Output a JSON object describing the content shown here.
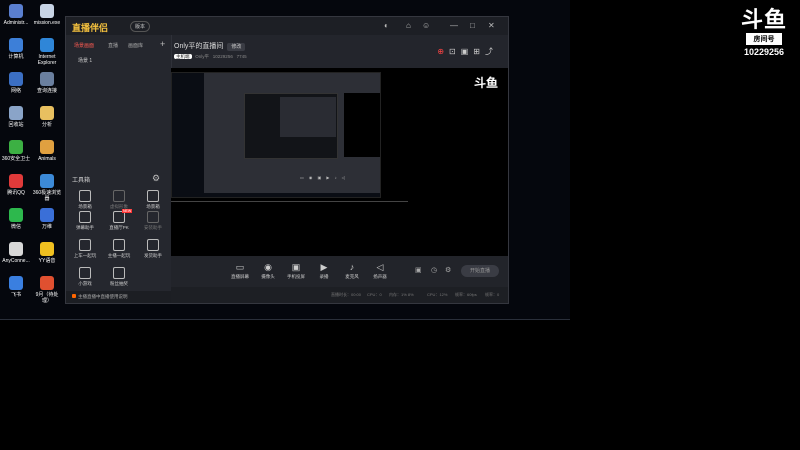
{
  "desktop": {
    "icons": [
      {
        "label": "Administr...",
        "color": "#5a7fd0"
      },
      {
        "label": "mission.exe",
        "color": "#c8d4e6"
      },
      {
        "label": "计算机",
        "color": "#3d7fd8"
      },
      {
        "label": "Internet Explorer",
        "color": "#2f86d8"
      },
      {
        "label": "网络",
        "color": "#3b6fc4"
      },
      {
        "label": "查询连接",
        "color": "#6a7f9f"
      },
      {
        "label": "回收站",
        "color": "#8aa4c8"
      },
      {
        "label": "分析",
        "color": "#e8c060"
      },
      {
        "label": "360安全卫士",
        "color": "#3cb043"
      },
      {
        "label": "Animals",
        "color": "#e0a040"
      },
      {
        "label": "腾讯QQ",
        "color": "#e03a3a"
      },
      {
        "label": "360极速浏览器",
        "color": "#3c8ad8"
      },
      {
        "label": "微信",
        "color": "#2db84d"
      },
      {
        "label": "万维",
        "color": "#3a6fd8"
      },
      {
        "label": "AnyConne...",
        "color": "#d8d8d8"
      },
      {
        "label": "YY语音",
        "color": "#f0c020"
      },
      {
        "label": "飞书",
        "color": "#3a7fe0"
      },
      {
        "label": "9月（待处理）",
        "color": "#e05030"
      }
    ]
  },
  "logo": {
    "mark": "斗鱼",
    "sub": "房间号",
    "room": "10229256"
  },
  "app": {
    "brand": "直播伴侣",
    "version_tag": "版本",
    "window_controls": [
      "◐",
      "⌂",
      "☺",
      "—",
      "□",
      "✕"
    ],
    "tabs": [
      "场景画面",
      "直播",
      "画面库"
    ],
    "add": "+",
    "scene": "场景 1",
    "tools_header": "工具箱",
    "tools": [
      {
        "label": "场景箱",
        "dim": false
      },
      {
        "label": "虚拟形象",
        "dim": true
      },
      {
        "label": "场景箱",
        "dim": false
      },
      {
        "label": "弹幕助手",
        "dim": false
      },
      {
        "label": "直播厅PK",
        "dim": false,
        "badge": "NEW"
      },
      {
        "label": "安装助手",
        "dim": true
      },
      {
        "label": "上车一起玩",
        "dim": false
      },
      {
        "label": "主播一起玩",
        "dim": false
      },
      {
        "label": "发货助手",
        "dim": false
      },
      {
        "label": "小游戏",
        "dim": false
      },
      {
        "label": "粉丝抽奖",
        "dim": false
      }
    ],
    "notice": "主播直播中直播使用说明",
    "room_title": "Only平的直播间",
    "room_tag": "修改",
    "room_meta": {
      "category": "主机端",
      "owner": "Only平",
      "room_id": "10229256",
      "viewers": "7745"
    },
    "header_icons": [
      "⊕",
      "⊡",
      "▣",
      "⊞",
      "⤴"
    ],
    "bottom_buttons": [
      {
        "label": "直播屏幕",
        "icon": "▭"
      },
      {
        "label": "摄像头",
        "icon": "◉"
      },
      {
        "label": "手机投屏",
        "icon": "▣"
      },
      {
        "label": "录播",
        "icon": "▶"
      },
      {
        "label": "麦克风",
        "icon": "♪"
      },
      {
        "label": "扬声器",
        "icon": "◁"
      }
    ],
    "start_button": "开始直播",
    "status": [
      "直播时长：00:00",
      "CPU：0",
      "内存：1% 8%",
      "CPU：12%",
      "帧率：60fps",
      "帧率：0"
    ]
  }
}
